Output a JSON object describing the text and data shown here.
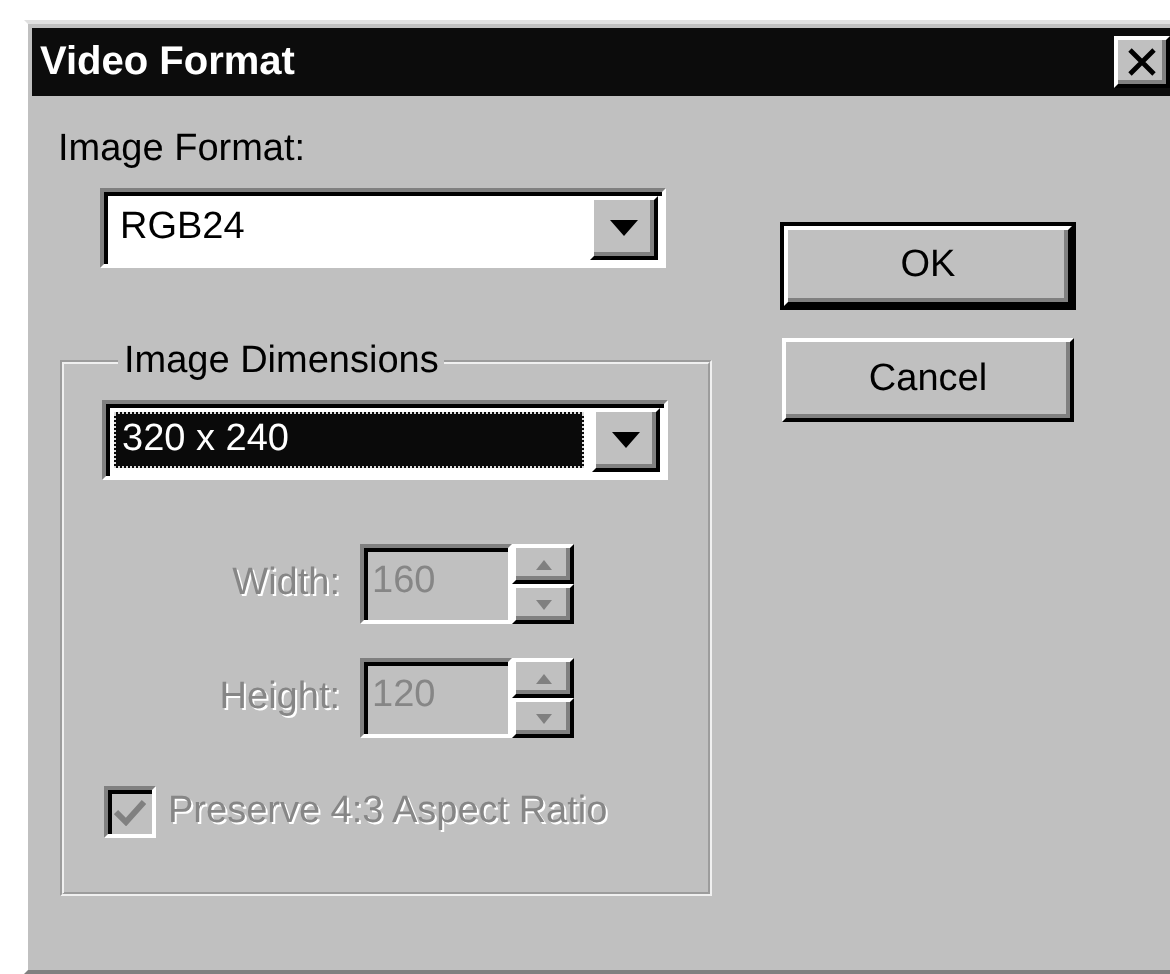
{
  "window": {
    "title": "Video Format"
  },
  "image_format": {
    "label": "Image Format:",
    "value": "RGB24",
    "focused": false
  },
  "buttons": [
    {
      "label": "OK",
      "default": true
    },
    {
      "label": "Cancel",
      "default": false
    }
  ],
  "image_dimensions": {
    "title": "Image Dimensions",
    "size": {
      "value": "320 x 240",
      "focused": true
    },
    "fields": [
      {
        "label": "Width:",
        "value": "160",
        "disabled": true
      },
      {
        "label": "Height:",
        "value": "120",
        "disabled": true
      }
    ],
    "preserve_aspect": {
      "label": "Preserve 4:3 Aspect Ratio",
      "checked": true,
      "disabled": true
    }
  }
}
